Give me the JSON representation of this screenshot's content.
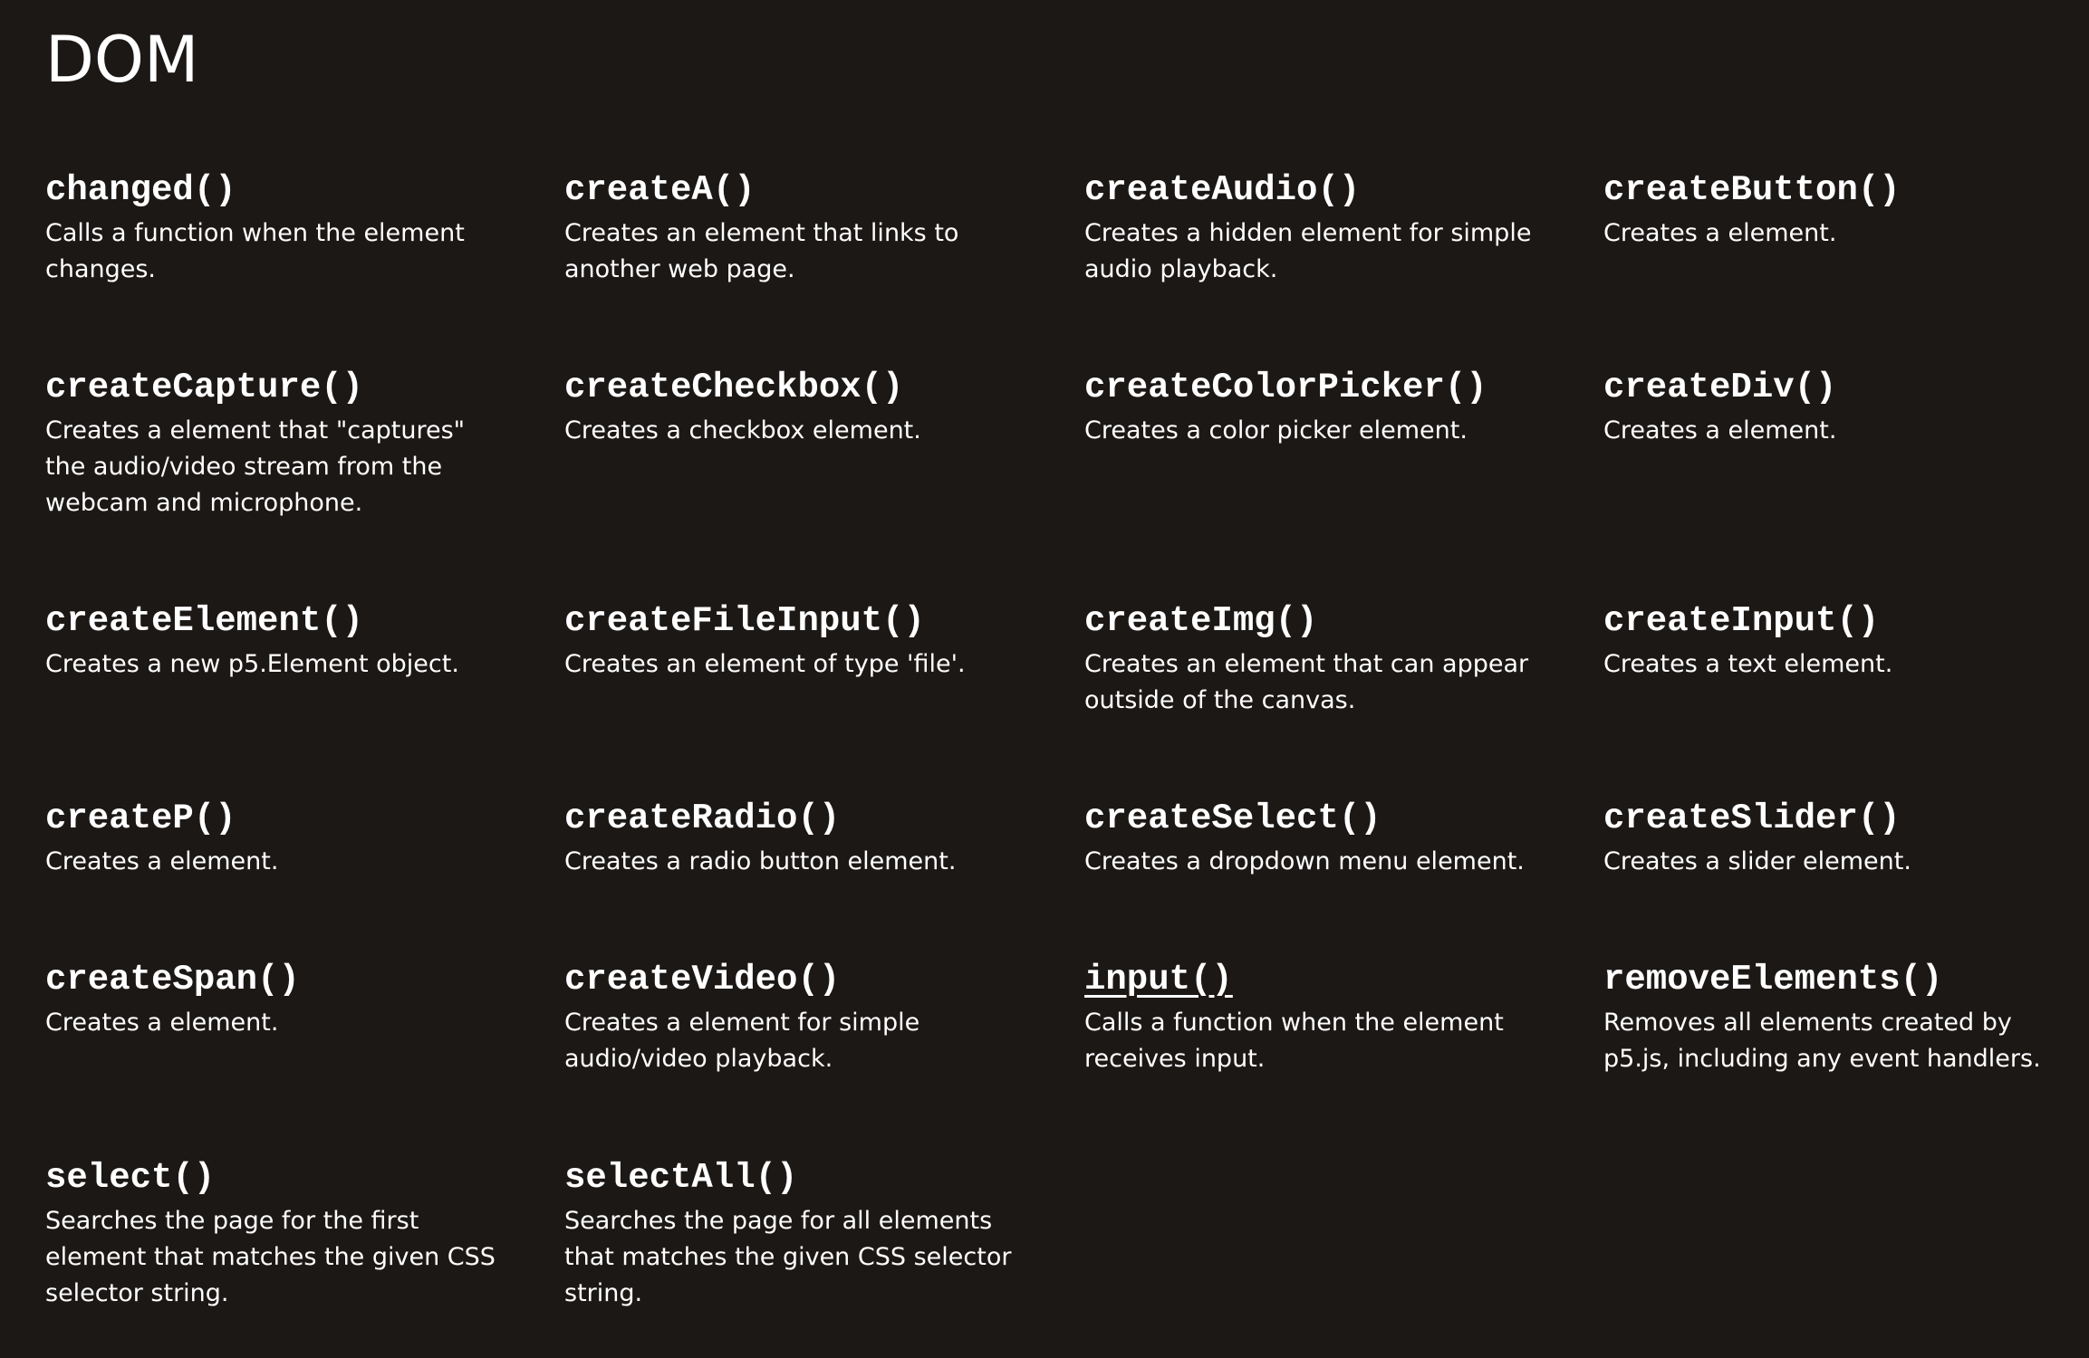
{
  "section": {
    "title": "DOM"
  },
  "items": [
    {
      "name": "changed()",
      "description": "Calls a function when the element changes."
    },
    {
      "name": "createA()",
      "description": "Creates an element that links to another web page."
    },
    {
      "name": "createAudio()",
      "description": "Creates a hidden element for simple audio playback."
    },
    {
      "name": "createButton()",
      "description": "Creates a element."
    },
    {
      "name": "createCapture()",
      "description": "Creates a element that \"captures\" the audio/video stream from the webcam and microphone."
    },
    {
      "name": "createCheckbox()",
      "description": "Creates a checkbox element."
    },
    {
      "name": "createColorPicker()",
      "description": "Creates a color picker element."
    },
    {
      "name": "createDiv()",
      "description": "Creates a element."
    },
    {
      "name": "createElement()",
      "description": "Creates a new p5.Element object."
    },
    {
      "name": "createFileInput()",
      "description": "Creates an element of type 'file'."
    },
    {
      "name": "createImg()",
      "description": "Creates an element that can appear outside of the canvas."
    },
    {
      "name": "createInput()",
      "description": "Creates a text element."
    },
    {
      "name": "createP()",
      "description": "Creates a element."
    },
    {
      "name": "createRadio()",
      "description": "Creates a radio button element."
    },
    {
      "name": "createSelect()",
      "description": "Creates a dropdown menu element."
    },
    {
      "name": "createSlider()",
      "description": "Creates a slider element."
    },
    {
      "name": "createSpan()",
      "description": "Creates a element."
    },
    {
      "name": "createVideo()",
      "description": "Creates a element for simple audio/video playback."
    },
    {
      "name": "input()",
      "description": "Calls a function when the element receives input.",
      "active": true
    },
    {
      "name": "removeElements()",
      "description": "Removes all elements created by p5.js, including any event handlers."
    },
    {
      "name": "select()",
      "description": "Searches the page for the first element that matches the given CSS selector string."
    },
    {
      "name": "selectAll()",
      "description": "Searches the page for all elements that matches the given CSS selector string."
    }
  ]
}
